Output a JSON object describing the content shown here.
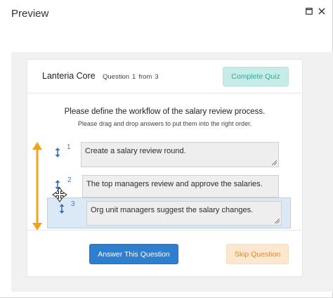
{
  "window": {
    "title": "Preview",
    "controls": [
      {
        "icon": "maximize-icon"
      },
      {
        "icon": "close-icon"
      }
    ]
  },
  "quiz": {
    "brand": "Lanteria Core",
    "question_label": "Question",
    "question_current": "1",
    "question_from": "from",
    "question_total": "3",
    "complete_label": "Complete Quiz",
    "question_text": "Please define the workflow of the salary review process.",
    "hint_text": "Please drag and drop answers to put them into the right order.",
    "answers": [
      {
        "num": "1",
        "text": "Create a salary review round."
      },
      {
        "num": "2",
        "text": "The top managers review and approve the salaries."
      },
      {
        "num": "3",
        "text": "Org unit managers suggest the salary changes.",
        "dragging": true
      }
    ],
    "answer_button": "Answer This Question",
    "skip_button": "Skip Question"
  },
  "colors": {
    "complete_bg": "#c6ece7",
    "complete_text": "#3aa599",
    "answer_bg": "#2f7fd0",
    "skip_bg": "#fde7cf",
    "skip_text": "#d98a3a",
    "drag_arrow": "#f0a321",
    "handle": "#3b6fc0",
    "drag_row_bg": "#dbe8f6"
  },
  "icons": {
    "drag_indicator": "vertical-double-arrow-icon",
    "reorder_handle": "updown-arrow-icon",
    "cursor": "move-cursor-icon"
  }
}
